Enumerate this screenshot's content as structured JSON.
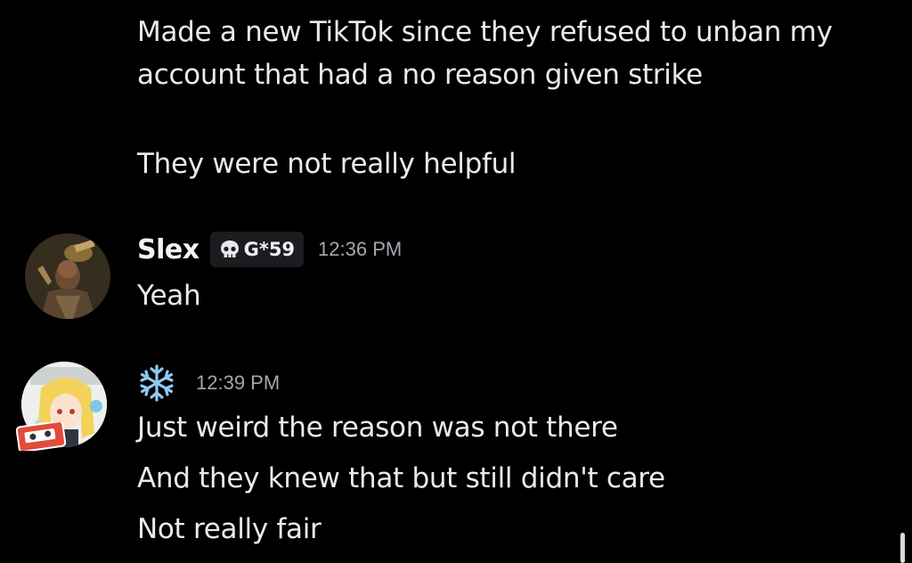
{
  "messages": {
    "continued": {
      "line1": "Made a new TikTok since they refused to unban my",
      "line2": "account that had a no reason given strike",
      "line3": "They were not really helpful"
    },
    "slex": {
      "username": "Slex",
      "tag": "G*59",
      "tag_icon": "skull-icon",
      "timestamp": "12:36 PM",
      "line1": "Yeah"
    },
    "snowflake_user": {
      "username_icon": "snowflake-icon",
      "timestamp": "12:39 PM",
      "line1": "Just weird the reason was not there",
      "line2": "And they knew that but still didn't care",
      "line3": "Not really fair"
    }
  },
  "colors": {
    "background": "#000000",
    "text": "#e9eaee",
    "timestamp": "#a3a6ad",
    "tag_background": "#1b1c20",
    "snowflake": "#8ec9f2"
  }
}
